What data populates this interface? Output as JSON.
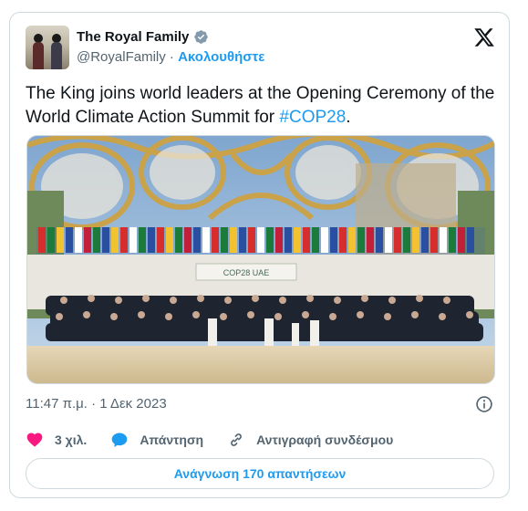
{
  "account": {
    "display_name": "The Royal Family",
    "handle": "@RoyalFamily",
    "separator": " · ",
    "follow_label": "Ακολουθήστε"
  },
  "tweet": {
    "text_before": "The King joins world leaders at the Opening Ceremony of the World Climate Action Summit for ",
    "hashtag": "#COP28",
    "text_after": "."
  },
  "photo": {
    "banner_text": "COP28 UAE"
  },
  "timestamp": "11:47 π.μ. · 1 Δεκ 2023",
  "actions": {
    "likes_label": "3 χιλ.",
    "reply_label": "Απάντηση",
    "copy_link_label": "Αντιγραφή συνδέσμου"
  },
  "replies_button_label": "Ανάγνωση 170 απαντήσεων",
  "icons": [
    "verified-icon",
    "x-logo-icon",
    "info-icon",
    "heart-icon",
    "reply-icon",
    "link-icon"
  ],
  "colors": {
    "accent": "#1d9bf0",
    "heart": "#f91880",
    "muted": "#536471",
    "border": "#cfd9de"
  }
}
